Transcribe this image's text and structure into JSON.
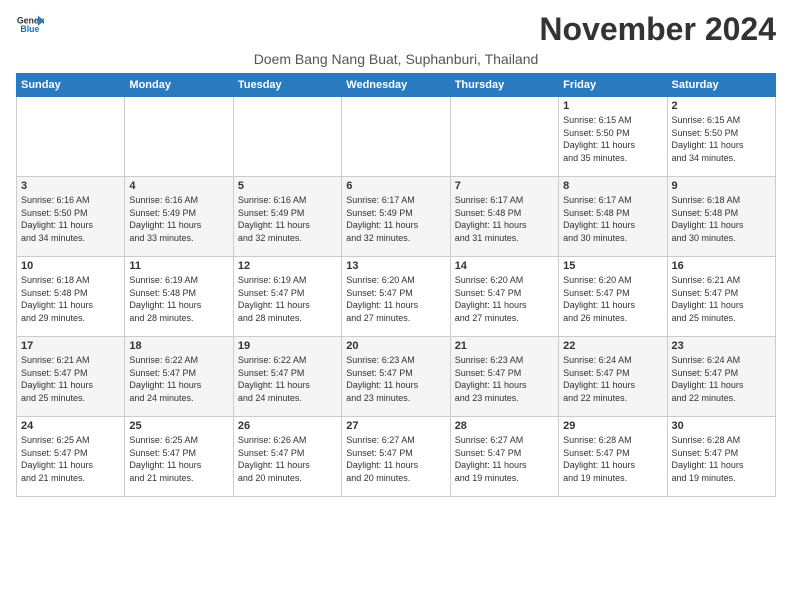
{
  "logo": {
    "line1": "General",
    "line2": "Blue"
  },
  "title": "November 2024",
  "subtitle": "Doem Bang Nang Buat, Suphanburi, Thailand",
  "days_header": [
    "Sunday",
    "Monday",
    "Tuesday",
    "Wednesday",
    "Thursday",
    "Friday",
    "Saturday"
  ],
  "weeks": [
    [
      {
        "day": "",
        "info": ""
      },
      {
        "day": "",
        "info": ""
      },
      {
        "day": "",
        "info": ""
      },
      {
        "day": "",
        "info": ""
      },
      {
        "day": "",
        "info": ""
      },
      {
        "day": "1",
        "info": "Sunrise: 6:15 AM\nSunset: 5:50 PM\nDaylight: 11 hours\nand 35 minutes."
      },
      {
        "day": "2",
        "info": "Sunrise: 6:15 AM\nSunset: 5:50 PM\nDaylight: 11 hours\nand 34 minutes."
      }
    ],
    [
      {
        "day": "3",
        "info": "Sunrise: 6:16 AM\nSunset: 5:50 PM\nDaylight: 11 hours\nand 34 minutes."
      },
      {
        "day": "4",
        "info": "Sunrise: 6:16 AM\nSunset: 5:49 PM\nDaylight: 11 hours\nand 33 minutes."
      },
      {
        "day": "5",
        "info": "Sunrise: 6:16 AM\nSunset: 5:49 PM\nDaylight: 11 hours\nand 32 minutes."
      },
      {
        "day": "6",
        "info": "Sunrise: 6:17 AM\nSunset: 5:49 PM\nDaylight: 11 hours\nand 32 minutes."
      },
      {
        "day": "7",
        "info": "Sunrise: 6:17 AM\nSunset: 5:48 PM\nDaylight: 11 hours\nand 31 minutes."
      },
      {
        "day": "8",
        "info": "Sunrise: 6:17 AM\nSunset: 5:48 PM\nDaylight: 11 hours\nand 30 minutes."
      },
      {
        "day": "9",
        "info": "Sunrise: 6:18 AM\nSunset: 5:48 PM\nDaylight: 11 hours\nand 30 minutes."
      }
    ],
    [
      {
        "day": "10",
        "info": "Sunrise: 6:18 AM\nSunset: 5:48 PM\nDaylight: 11 hours\nand 29 minutes."
      },
      {
        "day": "11",
        "info": "Sunrise: 6:19 AM\nSunset: 5:48 PM\nDaylight: 11 hours\nand 28 minutes."
      },
      {
        "day": "12",
        "info": "Sunrise: 6:19 AM\nSunset: 5:47 PM\nDaylight: 11 hours\nand 28 minutes."
      },
      {
        "day": "13",
        "info": "Sunrise: 6:20 AM\nSunset: 5:47 PM\nDaylight: 11 hours\nand 27 minutes."
      },
      {
        "day": "14",
        "info": "Sunrise: 6:20 AM\nSunset: 5:47 PM\nDaylight: 11 hours\nand 27 minutes."
      },
      {
        "day": "15",
        "info": "Sunrise: 6:20 AM\nSunset: 5:47 PM\nDaylight: 11 hours\nand 26 minutes."
      },
      {
        "day": "16",
        "info": "Sunrise: 6:21 AM\nSunset: 5:47 PM\nDaylight: 11 hours\nand 25 minutes."
      }
    ],
    [
      {
        "day": "17",
        "info": "Sunrise: 6:21 AM\nSunset: 5:47 PM\nDaylight: 11 hours\nand 25 minutes."
      },
      {
        "day": "18",
        "info": "Sunrise: 6:22 AM\nSunset: 5:47 PM\nDaylight: 11 hours\nand 24 minutes."
      },
      {
        "day": "19",
        "info": "Sunrise: 6:22 AM\nSunset: 5:47 PM\nDaylight: 11 hours\nand 24 minutes."
      },
      {
        "day": "20",
        "info": "Sunrise: 6:23 AM\nSunset: 5:47 PM\nDaylight: 11 hours\nand 23 minutes."
      },
      {
        "day": "21",
        "info": "Sunrise: 6:23 AM\nSunset: 5:47 PM\nDaylight: 11 hours\nand 23 minutes."
      },
      {
        "day": "22",
        "info": "Sunrise: 6:24 AM\nSunset: 5:47 PM\nDaylight: 11 hours\nand 22 minutes."
      },
      {
        "day": "23",
        "info": "Sunrise: 6:24 AM\nSunset: 5:47 PM\nDaylight: 11 hours\nand 22 minutes."
      }
    ],
    [
      {
        "day": "24",
        "info": "Sunrise: 6:25 AM\nSunset: 5:47 PM\nDaylight: 11 hours\nand 21 minutes."
      },
      {
        "day": "25",
        "info": "Sunrise: 6:25 AM\nSunset: 5:47 PM\nDaylight: 11 hours\nand 21 minutes."
      },
      {
        "day": "26",
        "info": "Sunrise: 6:26 AM\nSunset: 5:47 PM\nDaylight: 11 hours\nand 20 minutes."
      },
      {
        "day": "27",
        "info": "Sunrise: 6:27 AM\nSunset: 5:47 PM\nDaylight: 11 hours\nand 20 minutes."
      },
      {
        "day": "28",
        "info": "Sunrise: 6:27 AM\nSunset: 5:47 PM\nDaylight: 11 hours\nand 19 minutes."
      },
      {
        "day": "29",
        "info": "Sunrise: 6:28 AM\nSunset: 5:47 PM\nDaylight: 11 hours\nand 19 minutes."
      },
      {
        "day": "30",
        "info": "Sunrise: 6:28 AM\nSunset: 5:47 PM\nDaylight: 11 hours\nand 19 minutes."
      }
    ]
  ]
}
